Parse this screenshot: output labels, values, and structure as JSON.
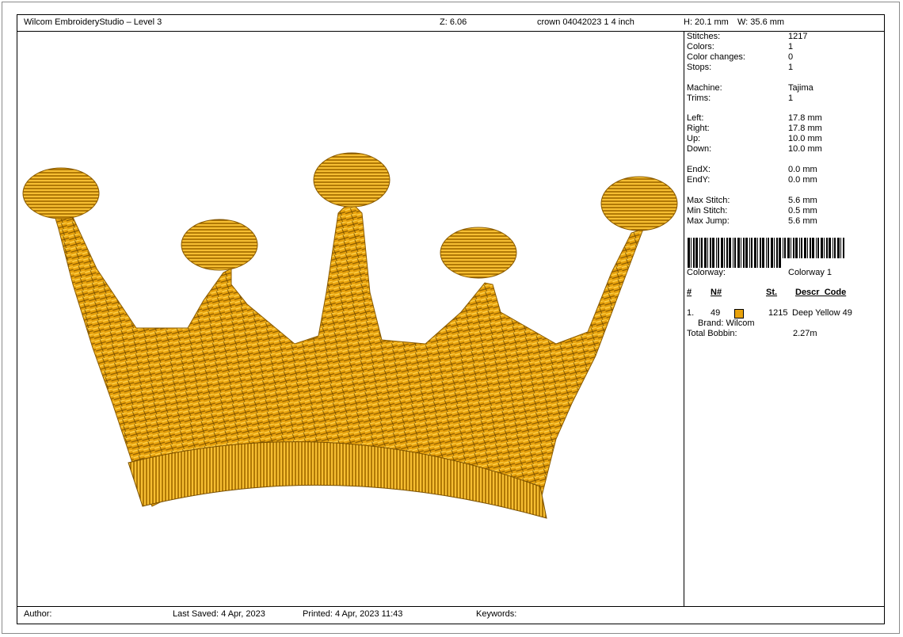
{
  "header": {
    "app_title": "Wilcom EmbroideryStudio – Level 3",
    "zoom": "Z: 6.06",
    "design_name": "crown 04042023 1  4 inch",
    "height": "H: 20.1 mm",
    "width": "W: 35.6 mm"
  },
  "stats": {
    "stitches": {
      "label": "Stitches:",
      "value": "1217"
    },
    "colors": {
      "label": "Colors:",
      "value": "1"
    },
    "color_changes": {
      "label": "Color changes:",
      "value": "0"
    },
    "stops": {
      "label": "Stops:",
      "value": "1"
    },
    "machine": {
      "label": "Machine:",
      "value": "Tajima"
    },
    "trims": {
      "label": "Trims:",
      "value": "1"
    },
    "left": {
      "label": "Left:",
      "value": "17.8 mm"
    },
    "right": {
      "label": "Right:",
      "value": "17.8 mm"
    },
    "up": {
      "label": "Up:",
      "value": "10.0 mm"
    },
    "down": {
      "label": "Down:",
      "value": "10.0 mm"
    },
    "endx": {
      "label": "EndX:",
      "value": "0.0 mm"
    },
    "endy": {
      "label": "EndY:",
      "value": "0.0 mm"
    },
    "max_stitch": {
      "label": "Max Stitch:",
      "value": "5.6 mm"
    },
    "min_stitch": {
      "label": "Min Stitch:",
      "value": "0.5 mm"
    },
    "max_jump": {
      "label": "Max Jump:",
      "value": "5.6 mm"
    }
  },
  "colorway": {
    "label": "Colorway:",
    "value": "Colorway 1"
  },
  "color_table": {
    "headers": {
      "num": "#",
      "n": "N#",
      "st": "St.",
      "descr": "Descr_Code"
    },
    "rows": [
      {
        "num": "1.",
        "n": "49",
        "swatch_color": "#e8a20c",
        "st": "1215",
        "descr": "Deep Yellow 49",
        "brand": "Brand: Wilcom"
      }
    ]
  },
  "total_bobbin": {
    "label": "Total Bobbin:",
    "value": "2.27m"
  },
  "footer": {
    "author_label": "Author:",
    "last_saved": "Last Saved:  4 Apr, 2023",
    "printed": "Printed:  4 Apr, 2023 11:43",
    "keywords_label": "Keywords:"
  },
  "design_colors": {
    "thread_main": "#e8a20c",
    "thread_dark": "#8a5b00",
    "thread_light": "#ffd24a"
  }
}
